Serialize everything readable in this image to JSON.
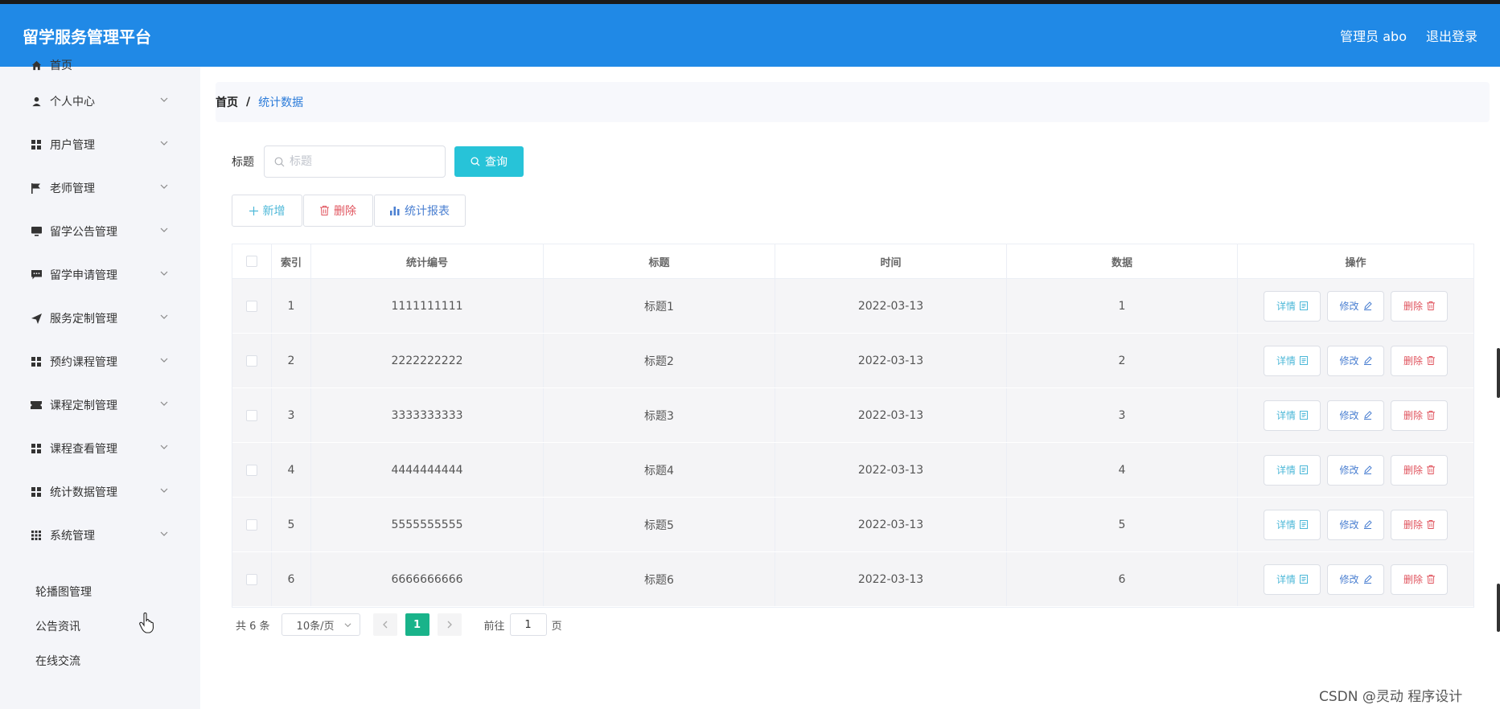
{
  "header": {
    "brand": "留学服务管理平台",
    "user": "管理员 abo",
    "logout": "退出登录"
  },
  "sidebar": {
    "items": [
      {
        "label": "首页",
        "icon": "home-icon"
      },
      {
        "label": "个人中心",
        "icon": "user-icon"
      },
      {
        "label": "用户管理",
        "icon": "grid-icon"
      },
      {
        "label": "老师管理",
        "icon": "flag-icon"
      },
      {
        "label": "留学公告管理",
        "icon": "monitor-icon"
      },
      {
        "label": "留学申请管理",
        "icon": "chat-icon"
      },
      {
        "label": "服务定制管理",
        "icon": "send-icon"
      },
      {
        "label": "预约课程管理",
        "icon": "grid-icon"
      },
      {
        "label": "课程定制管理",
        "icon": "ticket-icon"
      },
      {
        "label": "课程查看管理",
        "icon": "grid-icon"
      },
      {
        "label": "统计数据管理",
        "icon": "grid-icon"
      },
      {
        "label": "系统管理",
        "icon": "apps-icon"
      }
    ],
    "subitems": [
      "轮播图管理",
      "公告资讯",
      "在线交流"
    ]
  },
  "breadcrumb": {
    "home": "首页",
    "separator": "/",
    "current": "统计数据"
  },
  "search": {
    "label": "标题",
    "placeholder": "标题",
    "button": "查询"
  },
  "actions": {
    "add": "新增",
    "delete": "删除",
    "report": "统计报表"
  },
  "table": {
    "headers": [
      "索引",
      "统计编号",
      "标题",
      "时间",
      "数据",
      "操作"
    ],
    "rows": [
      {
        "index": "1",
        "code": "1111111111",
        "title": "标题1",
        "time": "2022-03-13",
        "data": "1"
      },
      {
        "index": "2",
        "code": "2222222222",
        "title": "标题2",
        "time": "2022-03-13",
        "data": "2"
      },
      {
        "index": "3",
        "code": "3333333333",
        "title": "标题3",
        "time": "2022-03-13",
        "data": "3"
      },
      {
        "index": "4",
        "code": "4444444444",
        "title": "标题4",
        "time": "2022-03-13",
        "data": "4"
      },
      {
        "index": "5",
        "code": "5555555555",
        "title": "标题5",
        "time": "2022-03-13",
        "data": "5"
      },
      {
        "index": "6",
        "code": "6666666666",
        "title": "标题6",
        "time": "2022-03-13",
        "data": "6"
      }
    ],
    "ops": {
      "detail": "详情",
      "edit": "修改",
      "delete": "删除"
    }
  },
  "pager": {
    "total": "共 6 条",
    "page_size": "10条/页",
    "current_page": "1",
    "goto_prefix": "前往",
    "goto_value": "1",
    "goto_suffix": "页"
  },
  "watermark": "CSDN @灵动 程序设计",
  "colors": {
    "header": "#2089e6",
    "query_button": "#27c3d8",
    "active_page": "#19b38a",
    "delete": "#e0535d",
    "edit": "#4a7fd1",
    "detail": "#4db8d8"
  }
}
